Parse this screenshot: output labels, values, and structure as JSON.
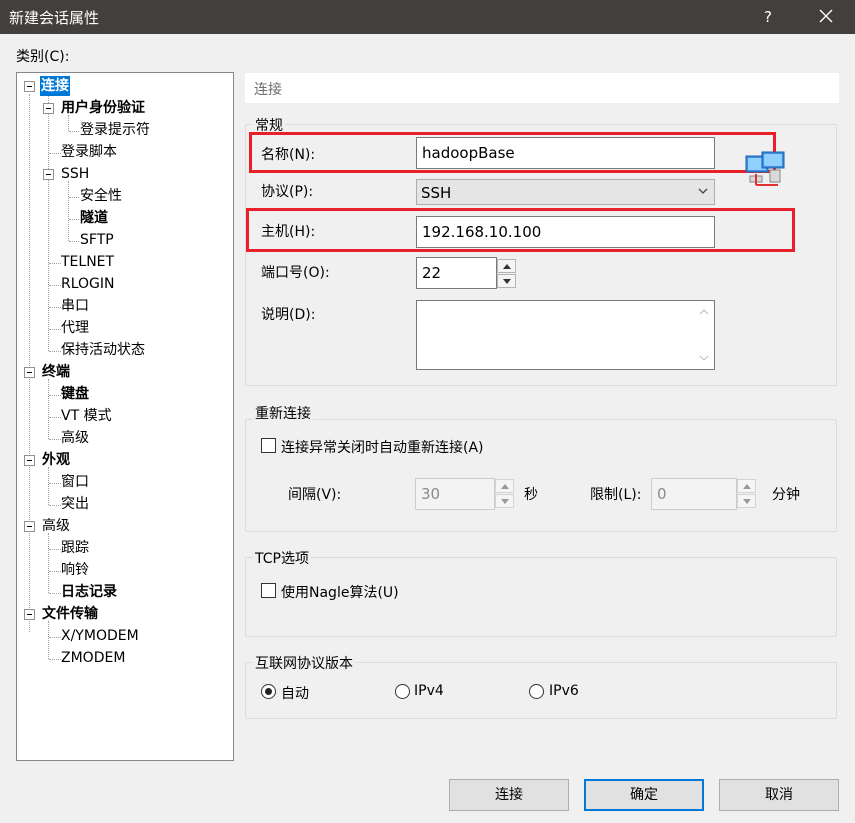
{
  "window": {
    "title": "新建会话属性",
    "help": "?",
    "colors": {
      "titlebar": "#423f3c",
      "accent": "#0078d7",
      "highlight": "#e8202a"
    }
  },
  "category_label": "类别(C):",
  "tree": [
    {
      "label": "连接",
      "selected": true,
      "bold": true,
      "expander": true
    },
    {
      "label": "用户身份验证",
      "bold": true,
      "expander": true
    },
    {
      "label": "登录提示符"
    },
    {
      "label": "登录脚本"
    },
    {
      "label": "SSH",
      "expander": true
    },
    {
      "label": "安全性"
    },
    {
      "label": "隧道",
      "bold": true
    },
    {
      "label": "SFTP"
    },
    {
      "label": "TELNET"
    },
    {
      "label": "RLOGIN"
    },
    {
      "label": "串口"
    },
    {
      "label": "代理"
    },
    {
      "label": "保持活动状态"
    },
    {
      "label": "终端",
      "bold": true,
      "expander": true
    },
    {
      "label": "键盘",
      "bold": true
    },
    {
      "label": "VT 模式"
    },
    {
      "label": "高级"
    },
    {
      "label": "外观",
      "bold": true,
      "expander": true
    },
    {
      "label": "窗口"
    },
    {
      "label": "突出"
    },
    {
      "label": "高级",
      "expander": true
    },
    {
      "label": "跟踪"
    },
    {
      "label": "响铃"
    },
    {
      "label": "日志记录",
      "bold": true
    },
    {
      "label": "文件传输",
      "bold": true,
      "expander": true
    },
    {
      "label": "X/YMODEM"
    },
    {
      "label": "ZMODEM"
    }
  ],
  "panel": {
    "header": "连接",
    "general": {
      "title": "常规",
      "name_label": "名称(N):",
      "name_value": "hadoopBase",
      "protocol_label": "协议(P):",
      "protocol_value": "SSH",
      "host_label": "主机(H):",
      "host_value": "192.168.10.100",
      "port_label": "端口号(O):",
      "port_value": "22",
      "desc_label": "说明(D):",
      "desc_value": ""
    },
    "reconnect": {
      "title": "重新连接",
      "checkbox_label": "连接异常关闭时自动重新连接(A)",
      "checked": false,
      "interval_label": "间隔(V):",
      "interval_value": "30",
      "interval_unit": "秒",
      "limit_label": "限制(L):",
      "limit_value": "0",
      "limit_unit": "分钟"
    },
    "tcp": {
      "title": "TCP选项",
      "nagle_label": "使用Nagle算法(U)",
      "checked": false
    },
    "ip_version": {
      "title": "互联网协议版本",
      "options": [
        "自动",
        "IPv4",
        "IPv6"
      ],
      "selected": "自动"
    }
  },
  "buttons": {
    "connect": "连接",
    "ok": "确定",
    "cancel": "取消"
  }
}
